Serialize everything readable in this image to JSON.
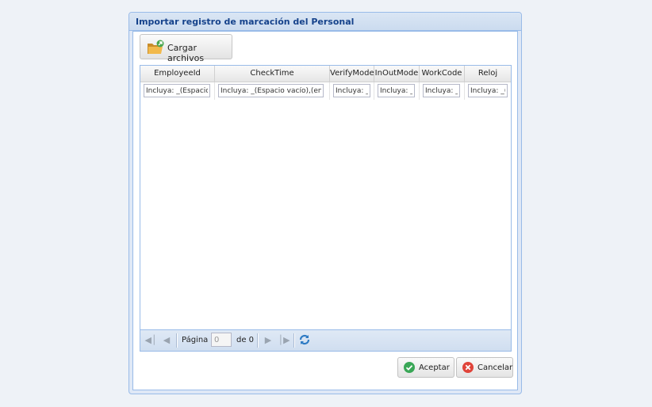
{
  "dialog": {
    "title": "Importar registro de marcación del Personal"
  },
  "toolbar": {
    "upload_label": "Cargar archivos"
  },
  "grid": {
    "columns": [
      {
        "label": "EmployeeId",
        "filter": "Incluya: _(Espacio vacío),(en"
      },
      {
        "label": "CheckTime",
        "filter": "Incluya: _(Espacio vacío),(en"
      },
      {
        "label": "VerifyMode",
        "filter": "Incluya: _(Espacio vacío)"
      },
      {
        "label": "InOutMode",
        "filter": "Incluya: _(Espacio vacío)"
      },
      {
        "label": "WorkCode",
        "filter": "Incluya: _(Espacio vacío)"
      },
      {
        "label": "Reloj",
        "filter": "Incluya: _(Espacio vacío)"
      }
    ]
  },
  "pager": {
    "page_label": "Página",
    "page_value": "0",
    "of_label": "de 0"
  },
  "footer": {
    "accept_label": "Aceptar",
    "cancel_label": "Cancelar"
  },
  "colors": {
    "title": "#15428b",
    "border": "#99bbe8",
    "accept_icon": "#3aa757",
    "cancel_icon": "#e0443a"
  }
}
